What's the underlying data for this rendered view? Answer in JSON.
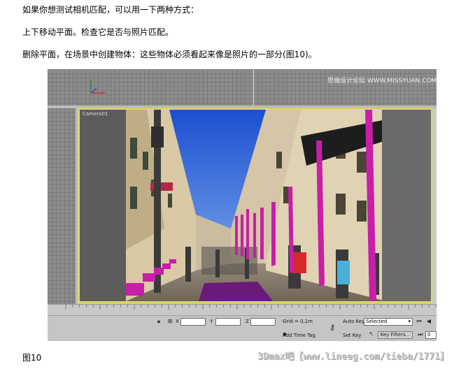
{
  "article": {
    "p1": "如果你想测试相机匹配，可以用一下两种方式：",
    "p2": "上下移动平面。检查它是否与照片匹配。",
    "p3": "删除平面，在场景中创建物体：这些物体必须看起来像是照片的一部分(图10)。",
    "figure_caption": "图10",
    "source_watermark": "3Dmax吧【www.lineeg.com/tieba/1771】"
  },
  "app": {
    "top_viewport_watermark": "思缘设计论坛  WWW.MISSYUAN.COM",
    "camera_viewport_label": "Camera01",
    "ruler_labels": [
      "50",
      "55",
      "60",
      "65",
      "70",
      "75",
      "80",
      "85",
      "90",
      "95",
      "100"
    ],
    "status": {
      "x_label": "X",
      "y_label": "Y",
      "z_label": "Z",
      "grid_text": "Grid = 0,1m",
      "auto_key_label": "Auto Key",
      "auto_key_value": "Selected",
      "set_key_label": "Set Key",
      "key_filters_label": "Key Filters...",
      "add_time_tag_label": "Add Time Tag",
      "frame_value": "0"
    },
    "colors": {
      "viewport_border": "#e6dc3c",
      "pillar": "#c81fa8",
      "sky": "#2f6fe0"
    }
  }
}
